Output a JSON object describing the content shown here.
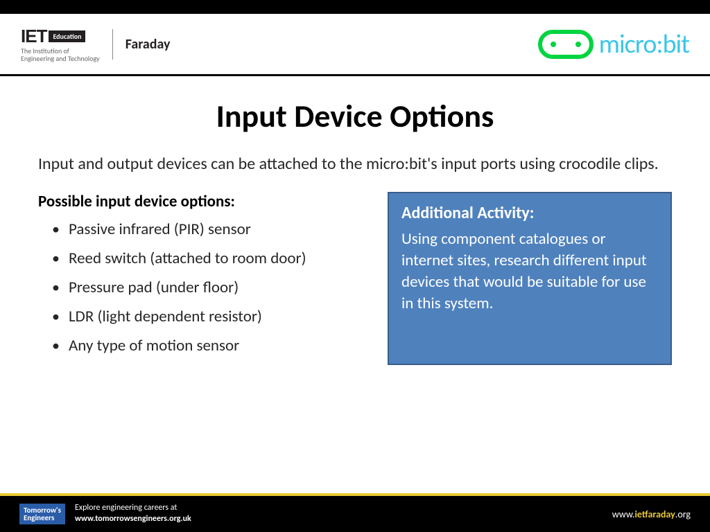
{
  "branding": {
    "iet_letters": "IET",
    "iet_education": "Education",
    "iet_sub1": "The Institution of",
    "iet_sub2": "Engineering and Technology",
    "faraday": "Faraday",
    "microbit": "micro:bit"
  },
  "title": "Input Device Options",
  "intro": "Input and output devices can be attached to the micro:bit's input ports using crocodile clips.",
  "options_title": "Possible input device options:",
  "options": [
    "Passive infrared (PIR) sensor",
    "Reed switch (attached to room door)",
    "Pressure pad (under floor)",
    "LDR (light dependent resistor)",
    "Any type of motion sensor"
  ],
  "activity": {
    "title": "Additional Activity:",
    "text": "Using component catalogues or internet sites, research different input devices that would be suitable for use in this system."
  },
  "footer": {
    "te_logo1": "Tomorrow's",
    "te_logo2": "Engineers",
    "te_line1": "Explore engineering careers at",
    "te_line2": "www.tomorrowsengineers.org.uk",
    "url_prefix": "www.",
    "url_main": "ietfaraday",
    "url_suffix": ".org"
  }
}
